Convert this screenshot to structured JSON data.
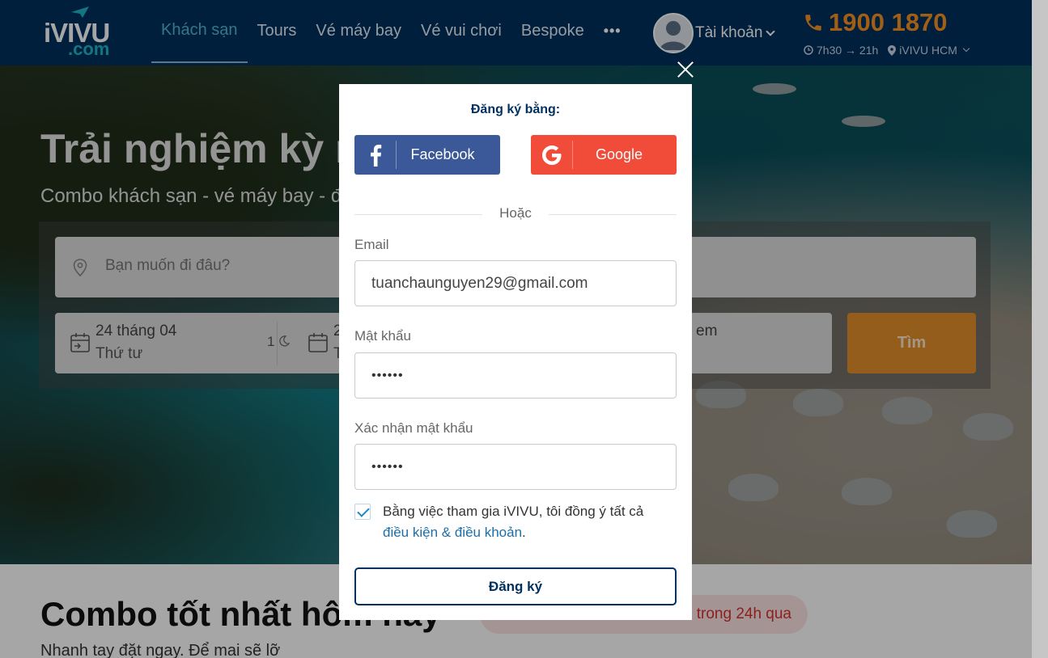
{
  "header": {
    "logo_text": "iVIVU",
    "logo_sub": ".com",
    "nav": [
      {
        "label": "Khách sạn",
        "active": true
      },
      {
        "label": "Tours"
      },
      {
        "label": "Vé máy bay"
      },
      {
        "label": "Vé vui chơi"
      },
      {
        "label": "Bespoke"
      }
    ],
    "nav_more": "•••",
    "account_label": "Tài khoản",
    "hotline": "1900 1870",
    "hours": "7h30 → 21h",
    "location": "iVIVU HCM"
  },
  "hero": {
    "title": "Trải nghiệm kỳ nghỉ tuyệt vời",
    "subtitle": "Combo khách sạn - vé máy bay - đưa đón sân bay giá tốt nhất",
    "search_placeholder": "Bạn muốn đi đâu?",
    "checkin_date": "24  tháng 04",
    "checkin_day": "Thứ tư",
    "nights": "1",
    "checkout_date": "2",
    "checkout_day": "T",
    "guests_partial": "em",
    "search_button": "Tìm"
  },
  "section": {
    "title": "Combo tốt nhất hôm nay",
    "badge": "trong 24h qua",
    "subtitle": "Nhanh tay đặt ngay. Để mai sẽ lỡ"
  },
  "modal": {
    "heading": "Đăng ký bằng:",
    "facebook_label": "Facebook",
    "google_label": "Google",
    "or_label": "Hoặc",
    "email_label": "Email",
    "email_value": "tuanchaunguyen29@gmail.com",
    "password_label": "Mật khẩu",
    "password_value": "••••••",
    "confirm_label": "Xác nhận mật khẩu",
    "confirm_value": "••••••",
    "terms_text": "Bằng việc tham gia iVIVU, tôi đồng ý tất cả",
    "terms_link": "điều kiện & điều khoản",
    "terms_end": ".",
    "submit_label": "Đăng ký"
  },
  "colors": {
    "header_bg": "#00305f",
    "accent_orange": "#f79321",
    "facebook": "#3b5998",
    "google": "#f14b3a"
  }
}
